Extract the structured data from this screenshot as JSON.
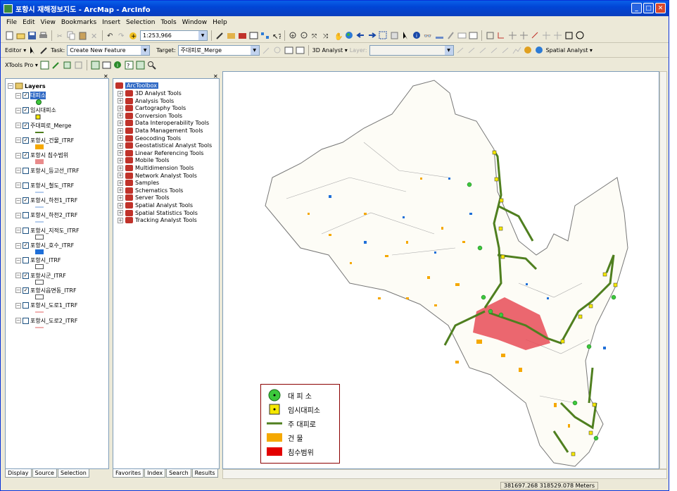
{
  "window": {
    "title": "포항시 재해정보지도 - ArcMap - ArcInfo"
  },
  "menu": [
    "File",
    "Edit",
    "View",
    "Bookmarks",
    "Insert",
    "Selection",
    "Tools",
    "Window",
    "Help"
  ],
  "toolbar": {
    "scale": "1:253,966"
  },
  "editor": {
    "editor_label": "Editor ▾",
    "task_label": "Task:",
    "task_value": "Create New Feature",
    "target_label": "Target:",
    "target_value": "주대피로_Merge",
    "analyst3d": "3D Analyst ▾",
    "layer_label": "Layer:",
    "spatial": "Spatial Analyst ▾"
  },
  "xtools": {
    "label": "XTools Pro ▾"
  },
  "toc": {
    "root": "Layers",
    "layers": [
      {
        "name": "대피소",
        "checked": true,
        "sym": "green-dot"
      },
      {
        "name": "임시대피소",
        "checked": true,
        "sym": "yellow-square"
      },
      {
        "name": "주대피로_Merge",
        "checked": true,
        "sym": "green-line"
      },
      {
        "name": "포항시_건물_ITRF",
        "checked": true,
        "sym": "orange-fill"
      },
      {
        "name": "포항시 침수범위",
        "checked": true,
        "sym": "pink-fill"
      },
      {
        "name": "포항시_등고선_ITRF",
        "checked": false,
        "sym": "none"
      },
      {
        "name": "포항시_철도_ITRF",
        "checked": false,
        "sym": "blue-line"
      },
      {
        "name": "포항시_하천1_ITRF",
        "checked": true,
        "sym": "blue-line"
      },
      {
        "name": "포항시_하천2_ITRF",
        "checked": false,
        "sym": "blue-line"
      },
      {
        "name": "포항시_지적도_ITRF",
        "checked": false,
        "sym": "empty-box"
      },
      {
        "name": "포항시_호수_ITRF",
        "checked": true,
        "sym": "blue-fill"
      },
      {
        "name": "포항시_ITRF",
        "checked": false,
        "sym": "empty-box"
      },
      {
        "name": "포항시군_ITRF",
        "checked": true,
        "sym": "empty-box"
      },
      {
        "name": "포항시읍면동_ITRF",
        "checked": true,
        "sym": "empty-box"
      },
      {
        "name": "포항시_도로1_ITRF",
        "checked": false,
        "sym": "red-line"
      },
      {
        "name": "포항시_도로2_ITRF",
        "checked": false,
        "sym": "red-line"
      }
    ]
  },
  "toc_tabs": [
    "Display",
    "Source",
    "Selection"
  ],
  "toolbox": {
    "root": "ArcToolbox",
    "tools": [
      "3D Analyst Tools",
      "Analysis Tools",
      "Cartography Tools",
      "Conversion Tools",
      "Data Interoperability Tools",
      "Data Management Tools",
      "Geocoding Tools",
      "Geostatistical Analyst Tools",
      "Linear Referencing Tools",
      "Mobile Tools",
      "Multidimension Tools",
      "Network Analyst Tools",
      "Samples",
      "Schematics Tools",
      "Server Tools",
      "Spatial Analyst Tools",
      "Spatial Statistics Tools",
      "Tracking Analyst Tools"
    ]
  },
  "toolbox_tabs": [
    "Favorites",
    "Index",
    "Search",
    "Results"
  ],
  "legend": {
    "items": [
      "대 피 소",
      "임시대피소",
      "주 대피로",
      "건 물",
      "침수범위"
    ]
  },
  "status": {
    "coords": "381697.268  318529.078 Meters"
  },
  "colors": {
    "title": "#0145d6",
    "green": "#3cc83c",
    "yellow": "#f5e800",
    "road": "#4f7f1f",
    "building": "#f5a800",
    "flood": "#e30000"
  }
}
